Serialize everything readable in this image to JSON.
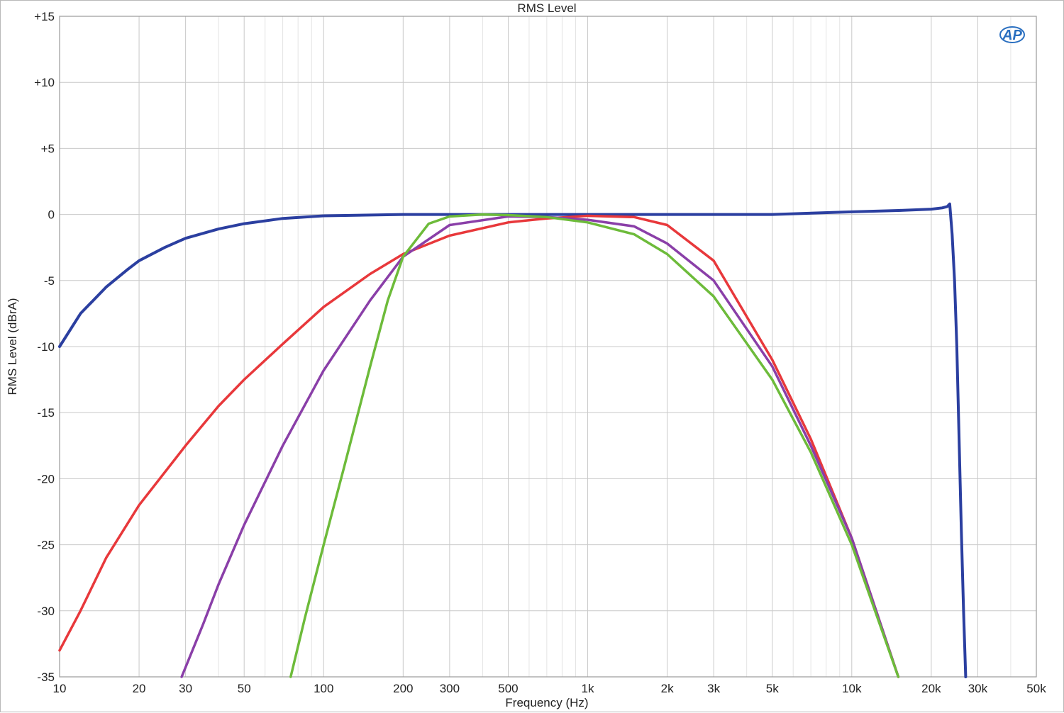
{
  "chart_data": {
    "type": "line",
    "title": "RMS Level",
    "xlabel": "Frequency (Hz)",
    "ylabel": "RMS Level (dBrA)",
    "x_scale": "log",
    "xlim": [
      10,
      50000
    ],
    "ylim": [
      -35,
      15
    ],
    "grid": true,
    "x_ticks": [
      10,
      20,
      30,
      50,
      100,
      200,
      300,
      500,
      1000,
      2000,
      3000,
      5000,
      10000,
      20000,
      30000,
      50000
    ],
    "x_tick_labels": [
      "10",
      "20",
      "30",
      "50",
      "100",
      "200",
      "300",
      "500",
      "1k",
      "2k",
      "3k",
      "5k",
      "10k",
      "20k",
      "30k",
      "50k"
    ],
    "y_ticks": [
      15,
      10,
      5,
      0,
      -5,
      -10,
      -15,
      -20,
      -25,
      -30,
      -35
    ],
    "y_tick_labels": [
      "+15",
      "+10",
      "+5",
      "0",
      "-5",
      "-10",
      "-15",
      "-20",
      "-25",
      "-30",
      "-35"
    ],
    "logo": "AP",
    "series": [
      {
        "color": "#2b3fa0",
        "x": [
          10,
          12,
          15,
          18,
          20,
          25,
          30,
          40,
          50,
          70,
          100,
          200,
          500,
          1000,
          2000,
          5000,
          10000,
          15000,
          20000,
          22000,
          23000,
          23500,
          24000,
          24500,
          25000,
          25500,
          26000,
          26500,
          27000
        ],
        "y": [
          -10,
          -7.5,
          -5.5,
          -4.2,
          -3.5,
          -2.5,
          -1.8,
          -1.1,
          -0.7,
          -0.3,
          -0.1,
          0,
          0,
          0,
          0,
          0,
          0.2,
          0.3,
          0.4,
          0.5,
          0.6,
          0.8,
          -1.5,
          -5,
          -10,
          -17,
          -24,
          -30,
          -35
        ]
      },
      {
        "color": "#e8383b",
        "x": [
          10,
          12,
          15,
          20,
          30,
          40,
          50,
          70,
          100,
          150,
          200,
          300,
          500,
          700,
          1000,
          1500,
          2000,
          3000,
          5000,
          7000,
          10000,
          15000
        ],
        "y": [
          -33,
          -30,
          -26,
          -22,
          -17.5,
          -14.5,
          -12.5,
          -9.8,
          -7,
          -4.5,
          -3,
          -1.6,
          -0.6,
          -0.3,
          -0.1,
          -0.2,
          -0.8,
          -3.5,
          -11,
          -17,
          -24.5,
          -35
        ]
      },
      {
        "color": "#8a3fa8",
        "x": [
          29,
          35,
          40,
          50,
          70,
          100,
          150,
          200,
          300,
          500,
          700,
          1000,
          1500,
          2000,
          3000,
          5000,
          7000,
          10000,
          15000
        ],
        "y": [
          -35,
          -31,
          -28,
          -23.5,
          -17.5,
          -11.8,
          -6.5,
          -3.2,
          -0.8,
          -0.15,
          -0.2,
          -0.4,
          -0.9,
          -2.2,
          -5,
          -11.5,
          -17.5,
          -24.5,
          -35
        ]
      },
      {
        "color": "#6dbb3a",
        "x": [
          75,
          85,
          100,
          120,
          150,
          175,
          200,
          250,
          300,
          400,
          500,
          700,
          1000,
          1500,
          2000,
          3000,
          5000,
          7000,
          10000,
          15000
        ],
        "y": [
          -35,
          -30.5,
          -25,
          -19,
          -11.5,
          -6.5,
          -3.2,
          -0.7,
          -0.15,
          0,
          -0.05,
          -0.2,
          -0.6,
          -1.5,
          -3,
          -6.2,
          -12.5,
          -18,
          -25,
          -35
        ]
      }
    ]
  }
}
